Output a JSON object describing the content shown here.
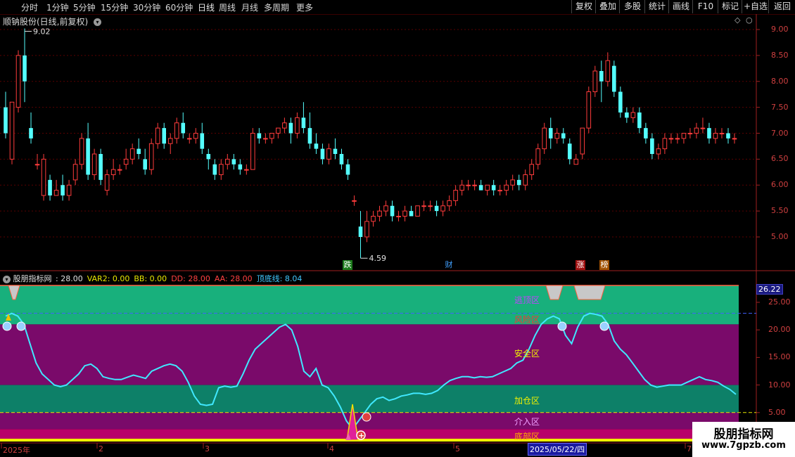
{
  "toolbar": {
    "periods": [
      "分时",
      "1分钟",
      "5分钟",
      "15分钟",
      "30分钟",
      "60分钟",
      "日线",
      "周线",
      "月线",
      "多周期",
      "更多"
    ],
    "right": [
      "复权",
      "叠加",
      "多股",
      "统计",
      "画线",
      "F10",
      "标记",
      "+自选",
      "返回"
    ]
  },
  "main_chart": {
    "title": "顺钠股份(日线,前复权)",
    "high_label": "9.02",
    "low_label": "4.59",
    "y_ticks": [
      "9.00",
      "8.50",
      "8.00",
      "7.50",
      "7.00",
      "6.50",
      "6.00",
      "5.50",
      "5.00"
    ],
    "event_markers": [
      "跌",
      "财",
      "涨",
      "榜"
    ],
    "candles": [
      {
        "o": 7.5,
        "h": 7.8,
        "c": 7.0,
        "l": 6.9
      },
      {
        "o": 6.5,
        "h": 7.3,
        "c": 7.6,
        "l": 6.4
      },
      {
        "o": 7.5,
        "h": 8.6,
        "c": 8.5,
        "l": 7.4
      },
      {
        "o": 8.5,
        "h": 9.02,
        "c": 8.0,
        "l": 7.6
      },
      {
        "o": 7.1,
        "h": 7.4,
        "c": 6.9,
        "l": 6.8
      },
      {
        "o": 6.4,
        "h": 6.6,
        "c": 6.4,
        "l": 6.3
      },
      {
        "o": 5.8,
        "h": 6.6,
        "c": 6.5,
        "l": 5.7
      },
      {
        "o": 6.1,
        "h": 6.2,
        "c": 5.8,
        "l": 5.7
      },
      {
        "o": 5.8,
        "h": 6.1,
        "c": 5.9,
        "l": 5.8
      },
      {
        "o": 6.0,
        "h": 6.2,
        "c": 5.8,
        "l": 5.7
      },
      {
        "o": 5.8,
        "h": 6.1,
        "c": 6.0,
        "l": 5.7
      },
      {
        "o": 6.1,
        "h": 6.5,
        "c": 6.4,
        "l": 6.0
      },
      {
        "o": 6.4,
        "h": 7.0,
        "c": 6.9,
        "l": 6.3
      },
      {
        "o": 6.9,
        "h": 7.2,
        "c": 6.2,
        "l": 6.1
      },
      {
        "o": 6.2,
        "h": 6.7,
        "c": 6.6,
        "l": 6.1
      },
      {
        "o": 6.6,
        "h": 6.7,
        "c": 6.1,
        "l": 6.0
      },
      {
        "o": 5.9,
        "h": 6.3,
        "c": 6.2,
        "l": 5.8
      },
      {
        "o": 6.2,
        "h": 6.5,
        "c": 6.3,
        "l": 6.1
      },
      {
        "o": 6.3,
        "h": 6.4,
        "c": 6.3,
        "l": 6.2
      },
      {
        "o": 6.4,
        "h": 6.7,
        "c": 6.5,
        "l": 6.3
      },
      {
        "o": 6.5,
        "h": 6.8,
        "c": 6.7,
        "l": 6.4
      },
      {
        "o": 6.7,
        "h": 6.9,
        "c": 6.6,
        "l": 6.5
      },
      {
        "o": 6.5,
        "h": 6.7,
        "c": 6.3,
        "l": 6.2
      },
      {
        "o": 6.3,
        "h": 6.9,
        "c": 6.8,
        "l": 6.2
      },
      {
        "o": 6.8,
        "h": 7.2,
        "c": 7.1,
        "l": 6.7
      },
      {
        "o": 7.1,
        "h": 7.2,
        "c": 6.8,
        "l": 6.7
      },
      {
        "o": 6.8,
        "h": 7.0,
        "c": 6.9,
        "l": 6.6
      },
      {
        "o": 6.9,
        "h": 7.3,
        "c": 7.2,
        "l": 6.8
      },
      {
        "o": 7.2,
        "h": 7.4,
        "c": 7.0,
        "l": 6.9
      },
      {
        "o": 6.9,
        "h": 7.0,
        "c": 6.9,
        "l": 6.8
      },
      {
        "o": 6.9,
        "h": 7.1,
        "c": 7.0,
        "l": 6.8
      },
      {
        "o": 7.0,
        "h": 7.2,
        "c": 6.7,
        "l": 6.6
      },
      {
        "o": 6.6,
        "h": 6.7,
        "c": 6.5,
        "l": 6.3
      },
      {
        "o": 6.4,
        "h": 6.5,
        "c": 6.2,
        "l": 6.1
      },
      {
        "o": 6.2,
        "h": 6.5,
        "c": 6.4,
        "l": 6.1
      },
      {
        "o": 6.4,
        "h": 6.6,
        "c": 6.5,
        "l": 6.3
      },
      {
        "o": 6.5,
        "h": 6.6,
        "c": 6.4,
        "l": 6.3
      },
      {
        "o": 6.4,
        "h": 6.5,
        "c": 6.3,
        "l": 6.2
      },
      {
        "o": 6.3,
        "h": 6.4,
        "c": 6.3,
        "l": 6.2
      },
      {
        "o": 6.3,
        "h": 7.1,
        "c": 7.0,
        "l": 6.3
      },
      {
        "o": 7.0,
        "h": 7.1,
        "c": 6.9,
        "l": 6.8
      },
      {
        "o": 6.9,
        "h": 7.0,
        "c": 6.9,
        "l": 6.8
      },
      {
        "o": 6.9,
        "h": 7.0,
        "c": 7.0,
        "l": 6.8
      },
      {
        "o": 7.0,
        "h": 7.1,
        "c": 7.1,
        "l": 6.9
      },
      {
        "o": 7.1,
        "h": 7.3,
        "c": 7.2,
        "l": 7.0
      },
      {
        "o": 7.2,
        "h": 7.3,
        "c": 7.0,
        "l": 6.8
      },
      {
        "o": 7.0,
        "h": 7.4,
        "c": 7.3,
        "l": 6.9
      },
      {
        "o": 7.3,
        "h": 7.6,
        "c": 7.1,
        "l": 7.0
      },
      {
        "o": 7.1,
        "h": 7.4,
        "c": 6.8,
        "l": 6.7
      },
      {
        "o": 6.8,
        "h": 7.0,
        "c": 6.7,
        "l": 6.6
      },
      {
        "o": 6.7,
        "h": 6.8,
        "c": 6.5,
        "l": 6.4
      },
      {
        "o": 6.5,
        "h": 6.8,
        "c": 6.7,
        "l": 6.4
      },
      {
        "o": 6.7,
        "h": 6.9,
        "c": 6.6,
        "l": 6.5
      },
      {
        "o": 6.6,
        "h": 6.7,
        "c": 6.4,
        "l": 6.3
      },
      {
        "o": 6.4,
        "h": 6.5,
        "c": 6.2,
        "l": 6.1
      },
      {
        "o": 5.7,
        "h": 5.8,
        "c": 5.7,
        "l": 5.6
      },
      {
        "o": 5.2,
        "h": 5.5,
        "c": 5.0,
        "l": 4.59
      },
      {
        "o": 5.0,
        "h": 5.5,
        "c": 5.3,
        "l": 4.9
      },
      {
        "o": 5.3,
        "h": 5.5,
        "c": 5.4,
        "l": 5.2
      },
      {
        "o": 5.4,
        "h": 5.6,
        "c": 5.5,
        "l": 5.3
      },
      {
        "o": 5.5,
        "h": 5.7,
        "c": 5.6,
        "l": 5.4
      },
      {
        "o": 5.6,
        "h": 5.7,
        "c": 5.4,
        "l": 5.3
      },
      {
        "o": 5.4,
        "h": 5.5,
        "c": 5.4,
        "l": 5.3
      },
      {
        "o": 5.4,
        "h": 5.6,
        "c": 5.5,
        "l": 5.3
      },
      {
        "o": 5.5,
        "h": 5.6,
        "c": 5.4,
        "l": 5.4
      },
      {
        "o": 5.4,
        "h": 5.6,
        "c": 5.6,
        "l": 5.4
      },
      {
        "o": 5.6,
        "h": 5.7,
        "c": 5.6,
        "l": 5.5
      },
      {
        "o": 5.6,
        "h": 5.7,
        "c": 5.6,
        "l": 5.5
      },
      {
        "o": 5.6,
        "h": 5.7,
        "c": 5.5,
        "l": 5.4
      },
      {
        "o": 5.5,
        "h": 5.7,
        "c": 5.6,
        "l": 5.4
      },
      {
        "o": 5.6,
        "h": 5.8,
        "c": 5.7,
        "l": 5.5
      },
      {
        "o": 5.7,
        "h": 6.0,
        "c": 5.9,
        "l": 5.6
      },
      {
        "o": 5.9,
        "h": 6.1,
        "c": 6.0,
        "l": 5.8
      },
      {
        "o": 6.0,
        "h": 6.1,
        "c": 6.0,
        "l": 5.9
      },
      {
        "o": 6.0,
        "h": 6.1,
        "c": 6.0,
        "l": 5.9
      },
      {
        "o": 6.0,
        "h": 6.1,
        "c": 5.9,
        "l": 5.9
      },
      {
        "o": 5.9,
        "h": 6.0,
        "c": 6.0,
        "l": 5.8
      },
      {
        "o": 6.0,
        "h": 6.1,
        "c": 5.9,
        "l": 5.8
      },
      {
        "o": 5.9,
        "h": 6.0,
        "c": 5.9,
        "l": 5.8
      },
      {
        "o": 5.9,
        "h": 6.1,
        "c": 6.0,
        "l": 5.8
      },
      {
        "o": 6.0,
        "h": 6.2,
        "c": 6.1,
        "l": 5.9
      },
      {
        "o": 6.1,
        "h": 6.2,
        "c": 6.0,
        "l": 5.9
      },
      {
        "o": 6.0,
        "h": 6.3,
        "c": 6.2,
        "l": 5.9
      },
      {
        "o": 6.2,
        "h": 6.5,
        "c": 6.4,
        "l": 6.1
      },
      {
        "o": 6.4,
        "h": 6.8,
        "c": 6.7,
        "l": 6.3
      },
      {
        "o": 6.7,
        "h": 7.2,
        "c": 7.1,
        "l": 6.6
      },
      {
        "o": 7.1,
        "h": 7.3,
        "c": 6.9,
        "l": 6.7
      },
      {
        "o": 6.9,
        "h": 7.1,
        "c": 7.0,
        "l": 6.8
      },
      {
        "o": 7.0,
        "h": 7.1,
        "c": 6.9,
        "l": 6.8
      },
      {
        "o": 6.8,
        "h": 6.9,
        "c": 6.5,
        "l": 6.4
      },
      {
        "o": 6.4,
        "h": 6.6,
        "c": 6.5,
        "l": 6.4
      },
      {
        "o": 6.6,
        "h": 7.1,
        "c": 7.1,
        "l": 6.5
      },
      {
        "o": 7.1,
        "h": 7.9,
        "c": 7.8,
        "l": 7.0
      },
      {
        "o": 7.8,
        "h": 8.3,
        "c": 8.2,
        "l": 7.7
      },
      {
        "o": 8.2,
        "h": 8.4,
        "c": 8.0,
        "l": 7.6
      },
      {
        "o": 8.0,
        "h": 8.56,
        "c": 8.4,
        "l": 7.9
      },
      {
        "o": 8.3,
        "h": 8.4,
        "c": 7.8,
        "l": 7.7
      },
      {
        "o": 7.8,
        "h": 7.9,
        "c": 7.4,
        "l": 7.3
      },
      {
        "o": 7.4,
        "h": 7.5,
        "c": 7.3,
        "l": 7.2
      },
      {
        "o": 7.3,
        "h": 7.5,
        "c": 7.4,
        "l": 7.2
      },
      {
        "o": 7.4,
        "h": 7.5,
        "c": 7.1,
        "l": 7.0
      },
      {
        "o": 7.1,
        "h": 7.2,
        "c": 6.9,
        "l": 6.8
      },
      {
        "o": 6.9,
        "h": 7.0,
        "c": 6.6,
        "l": 6.5
      },
      {
        "o": 6.6,
        "h": 6.8,
        "c": 6.7,
        "l": 6.5
      },
      {
        "o": 6.7,
        "h": 7.0,
        "c": 6.9,
        "l": 6.6
      },
      {
        "o": 6.9,
        "h": 7.0,
        "c": 6.9,
        "l": 6.8
      },
      {
        "o": 6.9,
        "h": 7.0,
        "c": 6.9,
        "l": 6.8
      },
      {
        "o": 6.9,
        "h": 7.0,
        "c": 7.0,
        "l": 6.8
      },
      {
        "o": 7.0,
        "h": 7.1,
        "c": 7.0,
        "l": 6.9
      },
      {
        "o": 7.0,
        "h": 7.2,
        "c": 7.1,
        "l": 6.9
      },
      {
        "o": 7.1,
        "h": 7.3,
        "c": 7.1,
        "l": 7.0
      },
      {
        "o": 7.1,
        "h": 7.2,
        "c": 6.9,
        "l": 6.8
      },
      {
        "o": 6.9,
        "h": 7.1,
        "c": 7.0,
        "l": 6.8
      },
      {
        "o": 7.0,
        "h": 7.1,
        "c": 7.0,
        "l": 6.9
      },
      {
        "o": 7.0,
        "h": 7.1,
        "c": 6.9,
        "l": 6.8
      },
      {
        "o": 6.9,
        "h": 7.0,
        "c": 6.9,
        "l": 6.8
      }
    ]
  },
  "indicator": {
    "name": "股朋指标网",
    "values": [
      {
        "label": ": 28.00",
        "color": "#e0e0e0"
      },
      {
        "label": "VAR2: 0.00",
        "color": "#e8e800"
      },
      {
        "label": "BB: 0.00",
        "color": "#e8e800"
      },
      {
        "label": "DD: 28.00",
        "color": "#ff4040"
      },
      {
        "label": "AA: 28.00",
        "color": "#ff4040"
      },
      {
        "label": "顶底线: 8.04",
        "color": "#40c8ff"
      }
    ],
    "y_ticks": [
      "25.00",
      "20.00",
      "15.00",
      "10.00",
      "5.00"
    ],
    "current_value": "26.22",
    "zones": [
      "逃顶区",
      "风险区",
      "安全区",
      "加仓区",
      "介入区",
      "底部区"
    ],
    "line_values": [
      22.5,
      23.0,
      22.5,
      21.0,
      17.5,
      14.0,
      12.0,
      11.0,
      10.0,
      9.7,
      10.0,
      11.0,
      12.0,
      13.5,
      13.8,
      13.0,
      11.5,
      11.2,
      11.0,
      11.0,
      11.4,
      11.8,
      11.5,
      11.2,
      12.5,
      13.0,
      13.5,
      13.8,
      13.5,
      12.5,
      10.5,
      8.0,
      6.5,
      6.3,
      6.5,
      9.5,
      9.8,
      9.6,
      9.8,
      12.0,
      14.5,
      16.5,
      17.5,
      18.5,
      19.5,
      20.5,
      21.0,
      20.0,
      17.0,
      12.5,
      11.5,
      13.0,
      10.0,
      9.5,
      8.0,
      6.0,
      3.5,
      2.0,
      3.5,
      5.0,
      6.5,
      7.5,
      7.8,
      7.2,
      7.5,
      8.0,
      8.2,
      8.5,
      8.5,
      8.3,
      8.5,
      9.0,
      10.0,
      10.8,
      11.2,
      11.5,
      11.5,
      11.3,
      11.5,
      11.4,
      11.5,
      12.0,
      12.5,
      13.0,
      14.0,
      14.5,
      16.5,
      19.0,
      21.0,
      22.0,
      22.5,
      22.0,
      19.0,
      17.5,
      20.5,
      22.5,
      23.0,
      22.8,
      22.5,
      21.0,
      18.0,
      16.5,
      15.5,
      14.0,
      12.5,
      11.0,
      10.0,
      9.6,
      9.8,
      10.0,
      10.0,
      10.0,
      10.5,
      11.0,
      11.5,
      11.0,
      10.8,
      10.5,
      9.8,
      9.2,
      8.3
    ]
  },
  "x_axis": {
    "labels": [
      "2025年",
      "2",
      "3",
      "4",
      "5",
      "6",
      "7"
    ]
  },
  "date_label": "2025/05/22/四",
  "watermark": {
    "line1": "股朋指标网",
    "line2": "www.7gpzb.com"
  }
}
